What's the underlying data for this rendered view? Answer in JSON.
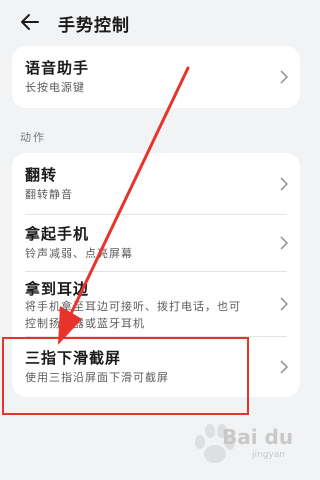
{
  "header": {
    "title": "手势控制",
    "back_icon": "back-arrow-icon"
  },
  "voice": {
    "title": "语音助手",
    "subtitle": "长按电源键"
  },
  "section": {
    "label": "动作"
  },
  "items": [
    {
      "title": "翻转",
      "subtitle": "翻转静音"
    },
    {
      "title": "拿起手机",
      "subtitle": "铃声减弱、点亮屏幕"
    },
    {
      "title": "拿到耳边",
      "subtitle_line1": "将手机拿至耳边可接听、拨打电话，也可",
      "subtitle_line2": "控制扬声器或蓝牙耳机"
    },
    {
      "title": "三指下滑截屏",
      "subtitle": "使用三指沿屏面下滑可截屏"
    }
  ],
  "annotation": {
    "color": "#e8332a"
  },
  "watermark": {
    "text": "Bai du",
    "sub": "jingyan"
  }
}
